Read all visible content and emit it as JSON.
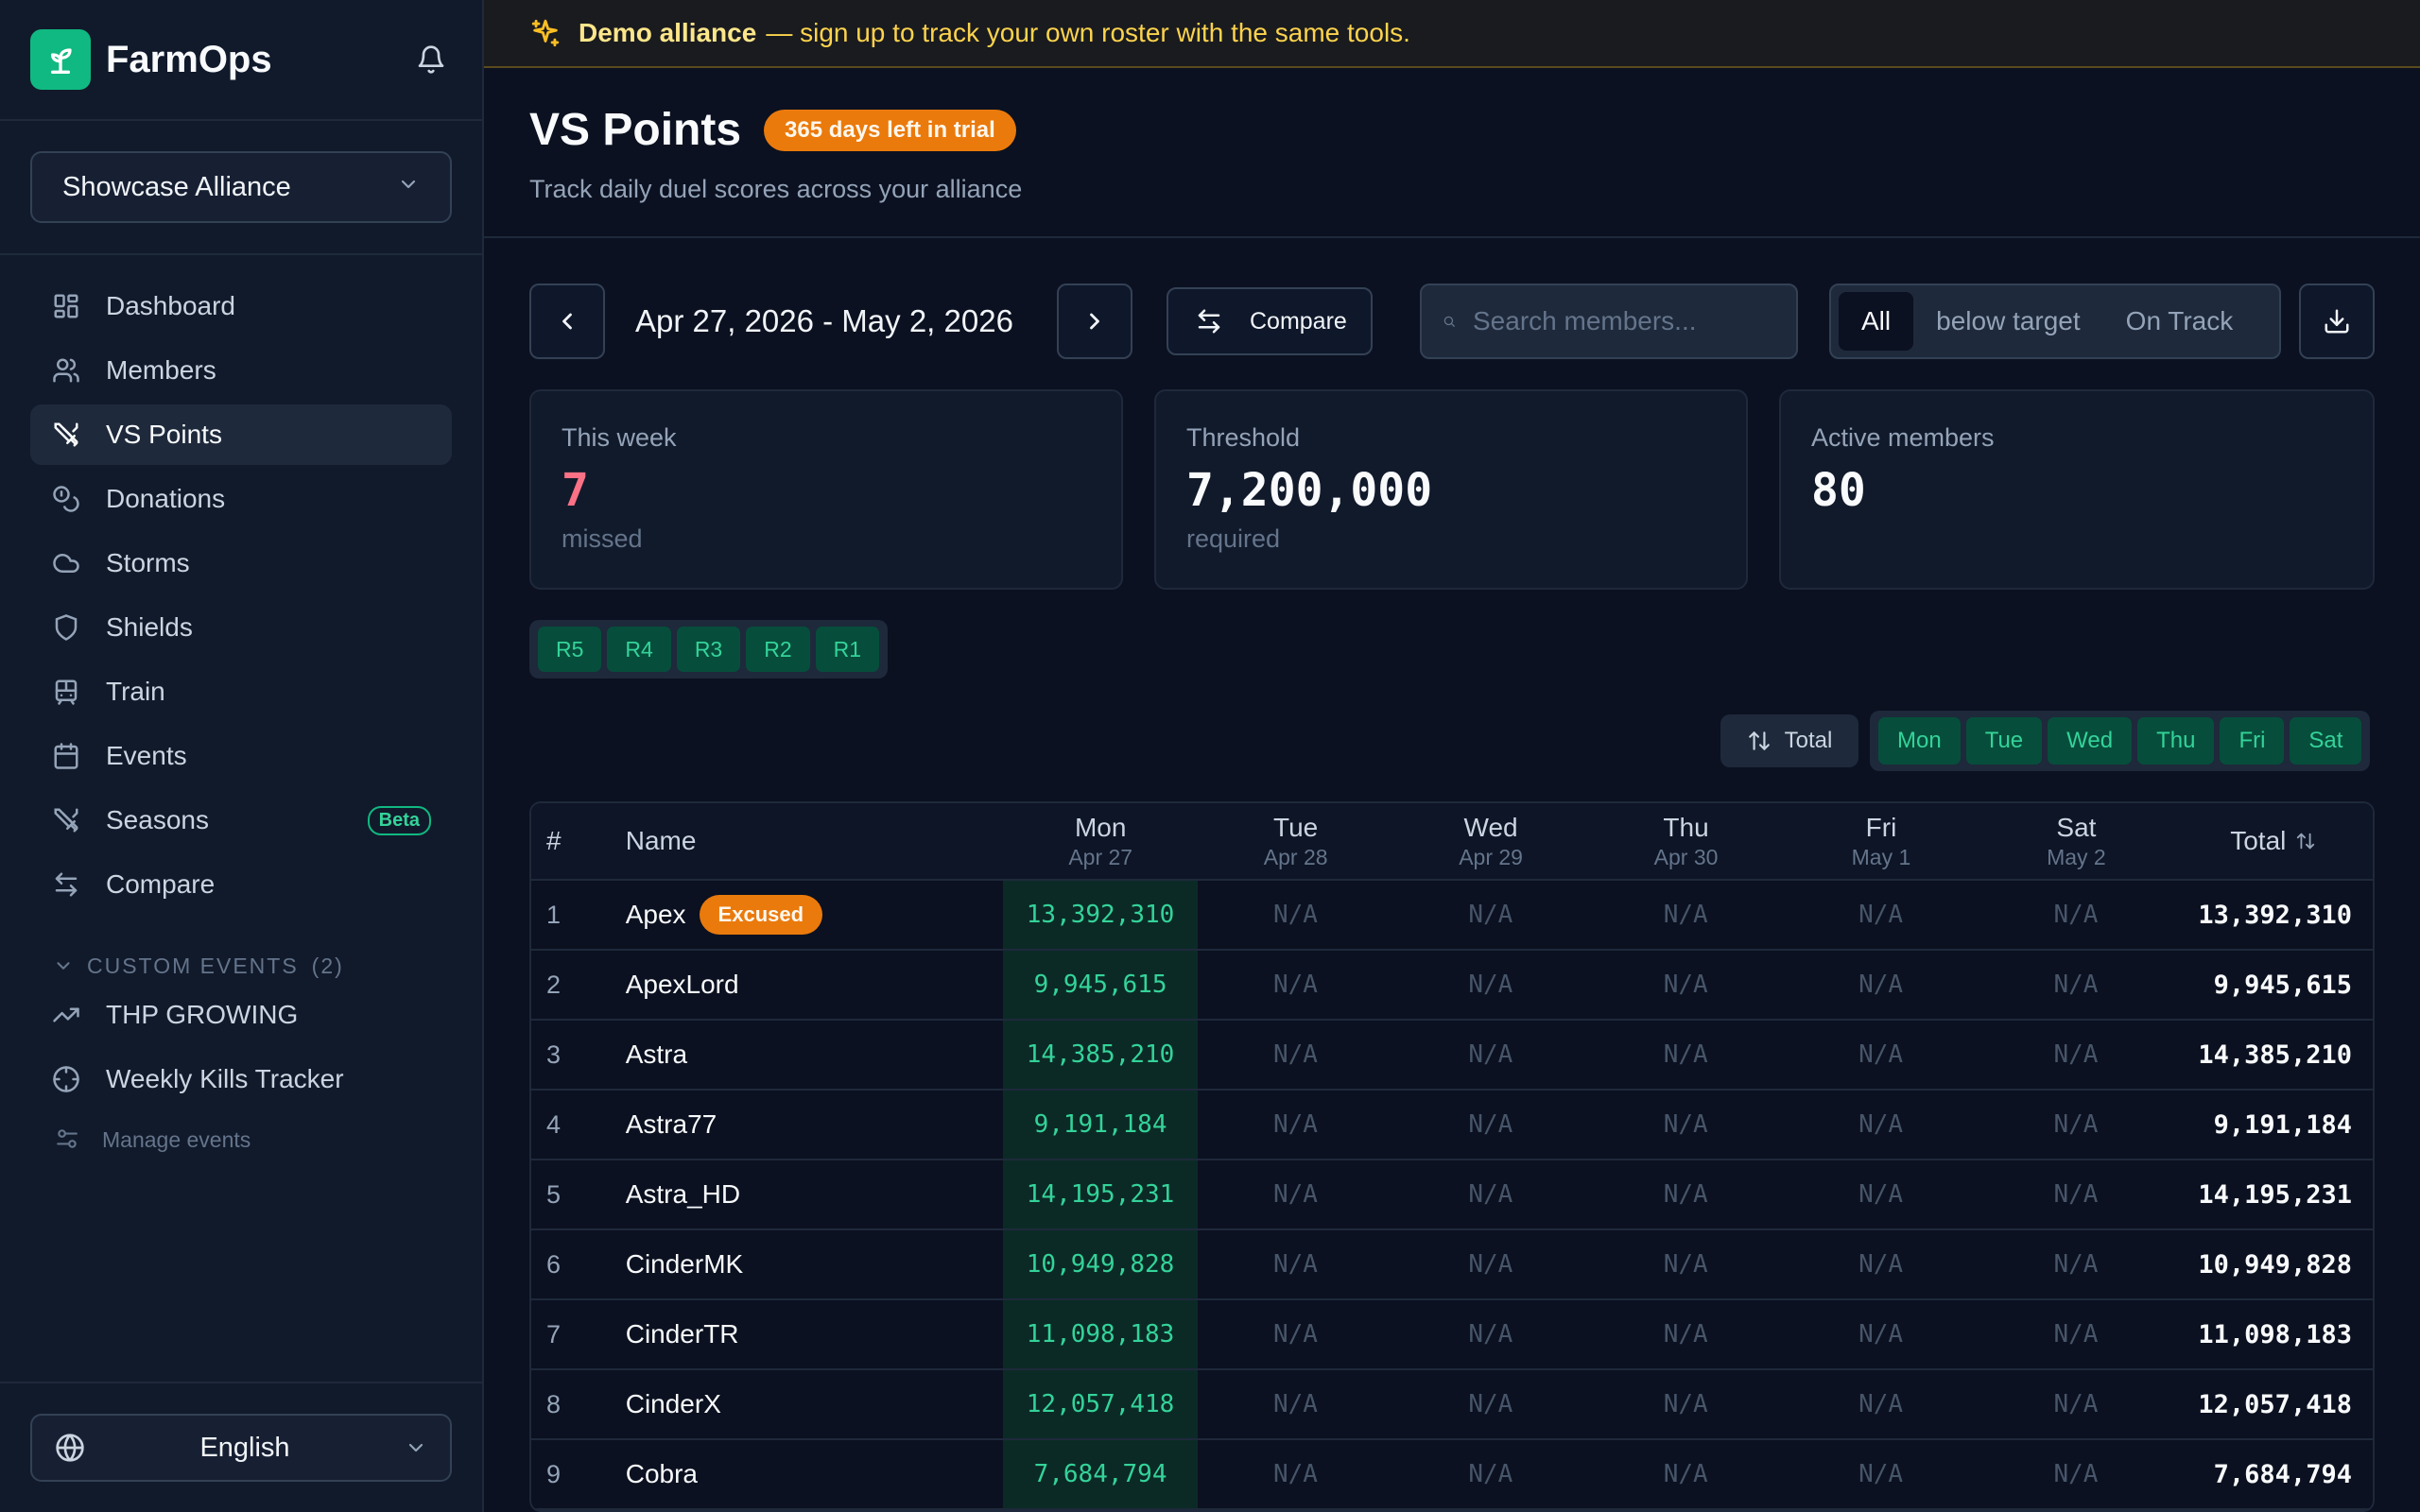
{
  "brand": {
    "name": "FarmOps"
  },
  "alliance": {
    "selected": "Showcase Alliance"
  },
  "nav": [
    {
      "id": "dashboard",
      "label": "Dashboard",
      "icon": "dashboard-icon"
    },
    {
      "id": "members",
      "label": "Members",
      "icon": "users-icon"
    },
    {
      "id": "vs-points",
      "label": "VS Points",
      "icon": "swords-icon",
      "active": true
    },
    {
      "id": "donations",
      "label": "Donations",
      "icon": "coins-icon"
    },
    {
      "id": "storms",
      "label": "Storms",
      "icon": "cloud-icon"
    },
    {
      "id": "shields",
      "label": "Shields",
      "icon": "shield-icon"
    },
    {
      "id": "train",
      "label": "Train",
      "icon": "train-icon"
    },
    {
      "id": "events",
      "label": "Events",
      "icon": "calendar-icon"
    },
    {
      "id": "seasons",
      "label": "Seasons",
      "icon": "swords-icon",
      "badge": "Beta"
    },
    {
      "id": "compare",
      "label": "Compare",
      "icon": "arrows-icon"
    }
  ],
  "custom_events": {
    "heading": "CUSTOM EVENTS",
    "count": "(2)",
    "items": [
      {
        "label": "THP GROWING",
        "icon": "trending-up-icon"
      },
      {
        "label": "Weekly Kills Tracker",
        "icon": "crosshair-icon"
      }
    ],
    "manage_label": "Manage events"
  },
  "language": {
    "selected": "English"
  },
  "banner": {
    "strong": "Demo alliance",
    "text": "— sign up to track your own roster with the same tools."
  },
  "header": {
    "title": "VS Points",
    "trial_badge": "365 days left in trial",
    "subtitle": "Track daily duel scores across your alliance"
  },
  "toolbar": {
    "date_range": "Apr 27, 2026 - May 2, 2026",
    "compare_label": "Compare",
    "search_placeholder": "Search members...",
    "filters": [
      {
        "label": "All",
        "active": true
      },
      {
        "label": "below target",
        "active": false
      },
      {
        "label": "On Track",
        "active": false
      }
    ]
  },
  "stats": [
    {
      "label": "This week",
      "value": "7",
      "sub": "missed",
      "accent": "#fb7185"
    },
    {
      "label": "Threshold",
      "value": "7,200,000",
      "sub": "required"
    },
    {
      "label": "Active members",
      "value": "80",
      "sub": ""
    }
  ],
  "ranks": [
    "R5",
    "R4",
    "R3",
    "R2",
    "R1"
  ],
  "sort": {
    "label": "Total"
  },
  "days": [
    "Mon",
    "Tue",
    "Wed",
    "Thu",
    "Fri",
    "Sat"
  ],
  "table": {
    "columns": {
      "num": "#",
      "name": "Name",
      "days": [
        {
          "day": "Mon",
          "date": "Apr 27"
        },
        {
          "day": "Tue",
          "date": "Apr 28"
        },
        {
          "day": "Wed",
          "date": "Apr 29"
        },
        {
          "day": "Thu",
          "date": "Apr 30"
        },
        {
          "day": "Fri",
          "date": "May 1"
        },
        {
          "day": "Sat",
          "date": "May 2"
        }
      ],
      "total": "Total"
    },
    "rows": [
      {
        "n": "1",
        "name": "Apex",
        "badge": "Excused",
        "mon": "13,392,310",
        "tue": "N/A",
        "wed": "N/A",
        "thu": "N/A",
        "fri": "N/A",
        "sat": "N/A",
        "total": "13,392,310"
      },
      {
        "n": "2",
        "name": "ApexLord",
        "mon": "9,945,615",
        "tue": "N/A",
        "wed": "N/A",
        "thu": "N/A",
        "fri": "N/A",
        "sat": "N/A",
        "total": "9,945,615"
      },
      {
        "n": "3",
        "name": "Astra",
        "mon": "14,385,210",
        "tue": "N/A",
        "wed": "N/A",
        "thu": "N/A",
        "fri": "N/A",
        "sat": "N/A",
        "total": "14,385,210"
      },
      {
        "n": "4",
        "name": "Astra77",
        "mon": "9,191,184",
        "tue": "N/A",
        "wed": "N/A",
        "thu": "N/A",
        "fri": "N/A",
        "sat": "N/A",
        "total": "9,191,184"
      },
      {
        "n": "5",
        "name": "Astra_HD",
        "mon": "14,195,231",
        "tue": "N/A",
        "wed": "N/A",
        "thu": "N/A",
        "fri": "N/A",
        "sat": "N/A",
        "total": "14,195,231"
      },
      {
        "n": "6",
        "name": "CinderMK",
        "mon": "10,949,828",
        "tue": "N/A",
        "wed": "N/A",
        "thu": "N/A",
        "fri": "N/A",
        "sat": "N/A",
        "total": "10,949,828"
      },
      {
        "n": "7",
        "name": "CinderTR",
        "mon": "11,098,183",
        "tue": "N/A",
        "wed": "N/A",
        "thu": "N/A",
        "fri": "N/A",
        "sat": "N/A",
        "total": "11,098,183"
      },
      {
        "n": "8",
        "name": "CinderX",
        "mon": "12,057,418",
        "tue": "N/A",
        "wed": "N/A",
        "thu": "N/A",
        "fri": "N/A",
        "sat": "N/A",
        "total": "12,057,418"
      },
      {
        "n": "9",
        "name": "Cobra",
        "mon": "7,684,794",
        "tue": "N/A",
        "wed": "N/A",
        "thu": "N/A",
        "fri": "N/A",
        "sat": "N/A",
        "total": "7,684,794"
      }
    ]
  }
}
